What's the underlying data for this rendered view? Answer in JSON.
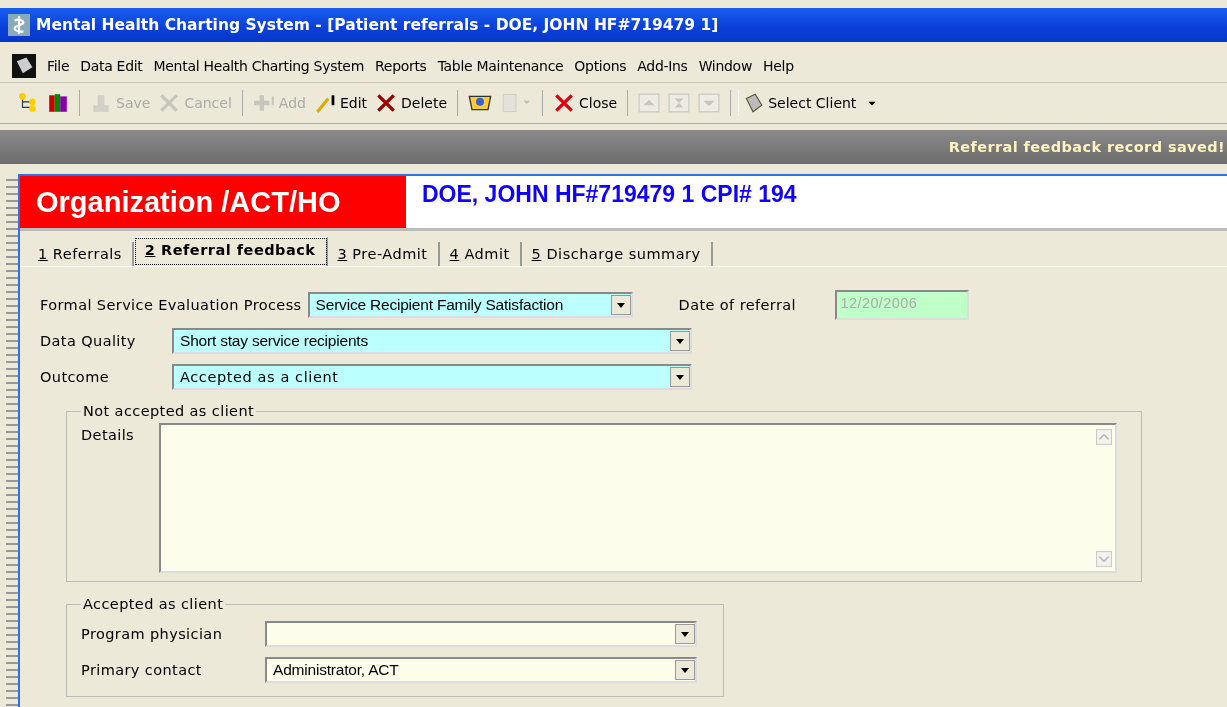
{
  "window": {
    "title": "Mental Health Charting System - [Patient referrals - DOE, JOHN  HF#719479 1]"
  },
  "menu": [
    "File",
    "Data Edit",
    "Mental Health Charting System",
    "Reports",
    "Table Maintenance",
    "Options",
    "Add-Ins",
    "Window",
    "Help"
  ],
  "toolbar": [
    {
      "kind": "tree",
      "disabled": false
    },
    {
      "kind": "books",
      "disabled": false
    },
    {
      "kind": "sep"
    },
    {
      "kind": "save",
      "label": "Save",
      "disabled": true
    },
    {
      "kind": "cancel",
      "label": "Cancel",
      "disabled": true
    },
    {
      "kind": "sep"
    },
    {
      "kind": "add",
      "label": "Add",
      "disabled": true
    },
    {
      "kind": "edit",
      "label": "Edit",
      "disabled": false
    },
    {
      "kind": "delete",
      "label": "Delete",
      "disabled": false
    },
    {
      "kind": "sep"
    },
    {
      "kind": "basket",
      "disabled": false
    },
    {
      "kind": "document",
      "disabled": true
    },
    {
      "kind": "sep"
    },
    {
      "kind": "close",
      "label": "Close",
      "disabled": false
    },
    {
      "kind": "sep"
    },
    {
      "kind": "up",
      "disabled": true
    },
    {
      "kind": "middle",
      "disabled": true
    },
    {
      "kind": "down",
      "disabled": true
    },
    {
      "kind": "sep"
    },
    {
      "kind": "client",
      "label": "Select Client",
      "disabled": false
    }
  ],
  "status_message": "Referral feedback record saved!",
  "header": {
    "organization": "Organization /ACT/HO",
    "patient": "DOE, JOHN  HF#719479 1 CPI# 194"
  },
  "tabs": [
    {
      "key": "1",
      "label": "Referrals",
      "selected": false
    },
    {
      "key": "2",
      "label": "Referral feedback",
      "selected": true
    },
    {
      "key": "3",
      "label": "Pre-Admit",
      "selected": false
    },
    {
      "key": "4",
      "label": "Admit",
      "selected": false
    },
    {
      "key": "5",
      "label": "Discharge summary",
      "selected": false
    }
  ],
  "form": {
    "evaluation": {
      "label": "Formal Service Evaluation Process",
      "value": "Service Recipient Family Satisfaction",
      "required": true
    },
    "date_of_referral": {
      "label": "Date of referral",
      "value": "12/20/2006",
      "disabled": true
    },
    "data_quality": {
      "label": "Data Quality",
      "value": "Short stay service recipients",
      "required": true
    },
    "outcome": {
      "label": "Outcome",
      "value": "Accepted as a client",
      "required": true
    }
  },
  "not_accepted": {
    "title": "Not accepted as client",
    "details_label": "Details"
  },
  "accepted": {
    "title": "Accepted as client",
    "fields": [
      {
        "label": "Program physician",
        "required": false
      },
      {
        "label": "Primary contact",
        "value": "Administrator, ACT",
        "required": false
      }
    ]
  }
}
